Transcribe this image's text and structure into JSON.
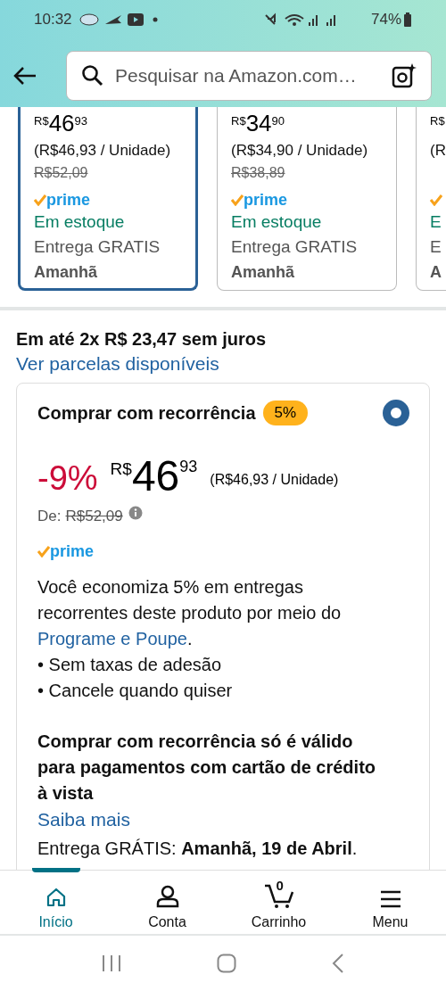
{
  "status_bar": {
    "time": "10:32",
    "battery": "74%"
  },
  "search": {
    "placeholder": "Pesquisar na Amazon.com…"
  },
  "offers": [
    {
      "currency": "R$",
      "whole": "46",
      "fraction": "93",
      "unit_price": "(R$46,93 / Unidade)",
      "list_price": "R$52,09",
      "prime": "prime",
      "stock": "Em estoque",
      "delivery": "Entrega GRATIS",
      "date": "Amanhã",
      "selected": true
    },
    {
      "currency": "R$",
      "whole": "34",
      "fraction": "90",
      "unit_price": "(R$34,90 / Unidade)",
      "list_price": "R$38,89",
      "prime": "prime",
      "stock": "Em estoque",
      "delivery": "Entrega GRATIS",
      "date": "Amanhã",
      "selected": false
    },
    {
      "currency": "R$",
      "unit_price": "(R",
      "stock": "E",
      "delivery": "E",
      "date": "A",
      "selected": false
    }
  ],
  "installments": {
    "text": "Em até 2x R$ 23,47 sem juros",
    "link": "Ver parcelas disponíveis"
  },
  "subscription": {
    "title": "Comprar com recorrência",
    "badge": "5%",
    "selected": true,
    "discount": "-9%",
    "currency": "R$",
    "whole": "46",
    "fraction": "93",
    "unit_price": "(R$46,93 / Unidade)",
    "list_label": "De:",
    "list_price": "R$52,09",
    "prime": "prime",
    "description": {
      "before": "Você economiza 5% em entregas recorrentes deste produto por meio do ",
      "link": "Programe e Poupe",
      "after": "."
    },
    "bullets": [
      "• Sem taxas de adesão",
      "• Cancele quando quiser"
    ],
    "notice": "Comprar com recorrência só é válido para pagamentos com cartão de crédito à vista",
    "notice_link": "Saiba mais",
    "delivery": "Entrega GRÁTIS: **Amanhã, 19 de Abril**."
  },
  "bottom_nav": [
    {
      "kind": "home",
      "label": "Início",
      "selected": true
    },
    {
      "kind": "account",
      "label": "Conta",
      "selected": false
    },
    {
      "kind": "cart",
      "label": "Carrinho",
      "count": "0",
      "selected": false
    },
    {
      "kind": "menu",
      "label": "Menu",
      "selected": false
    }
  ]
}
